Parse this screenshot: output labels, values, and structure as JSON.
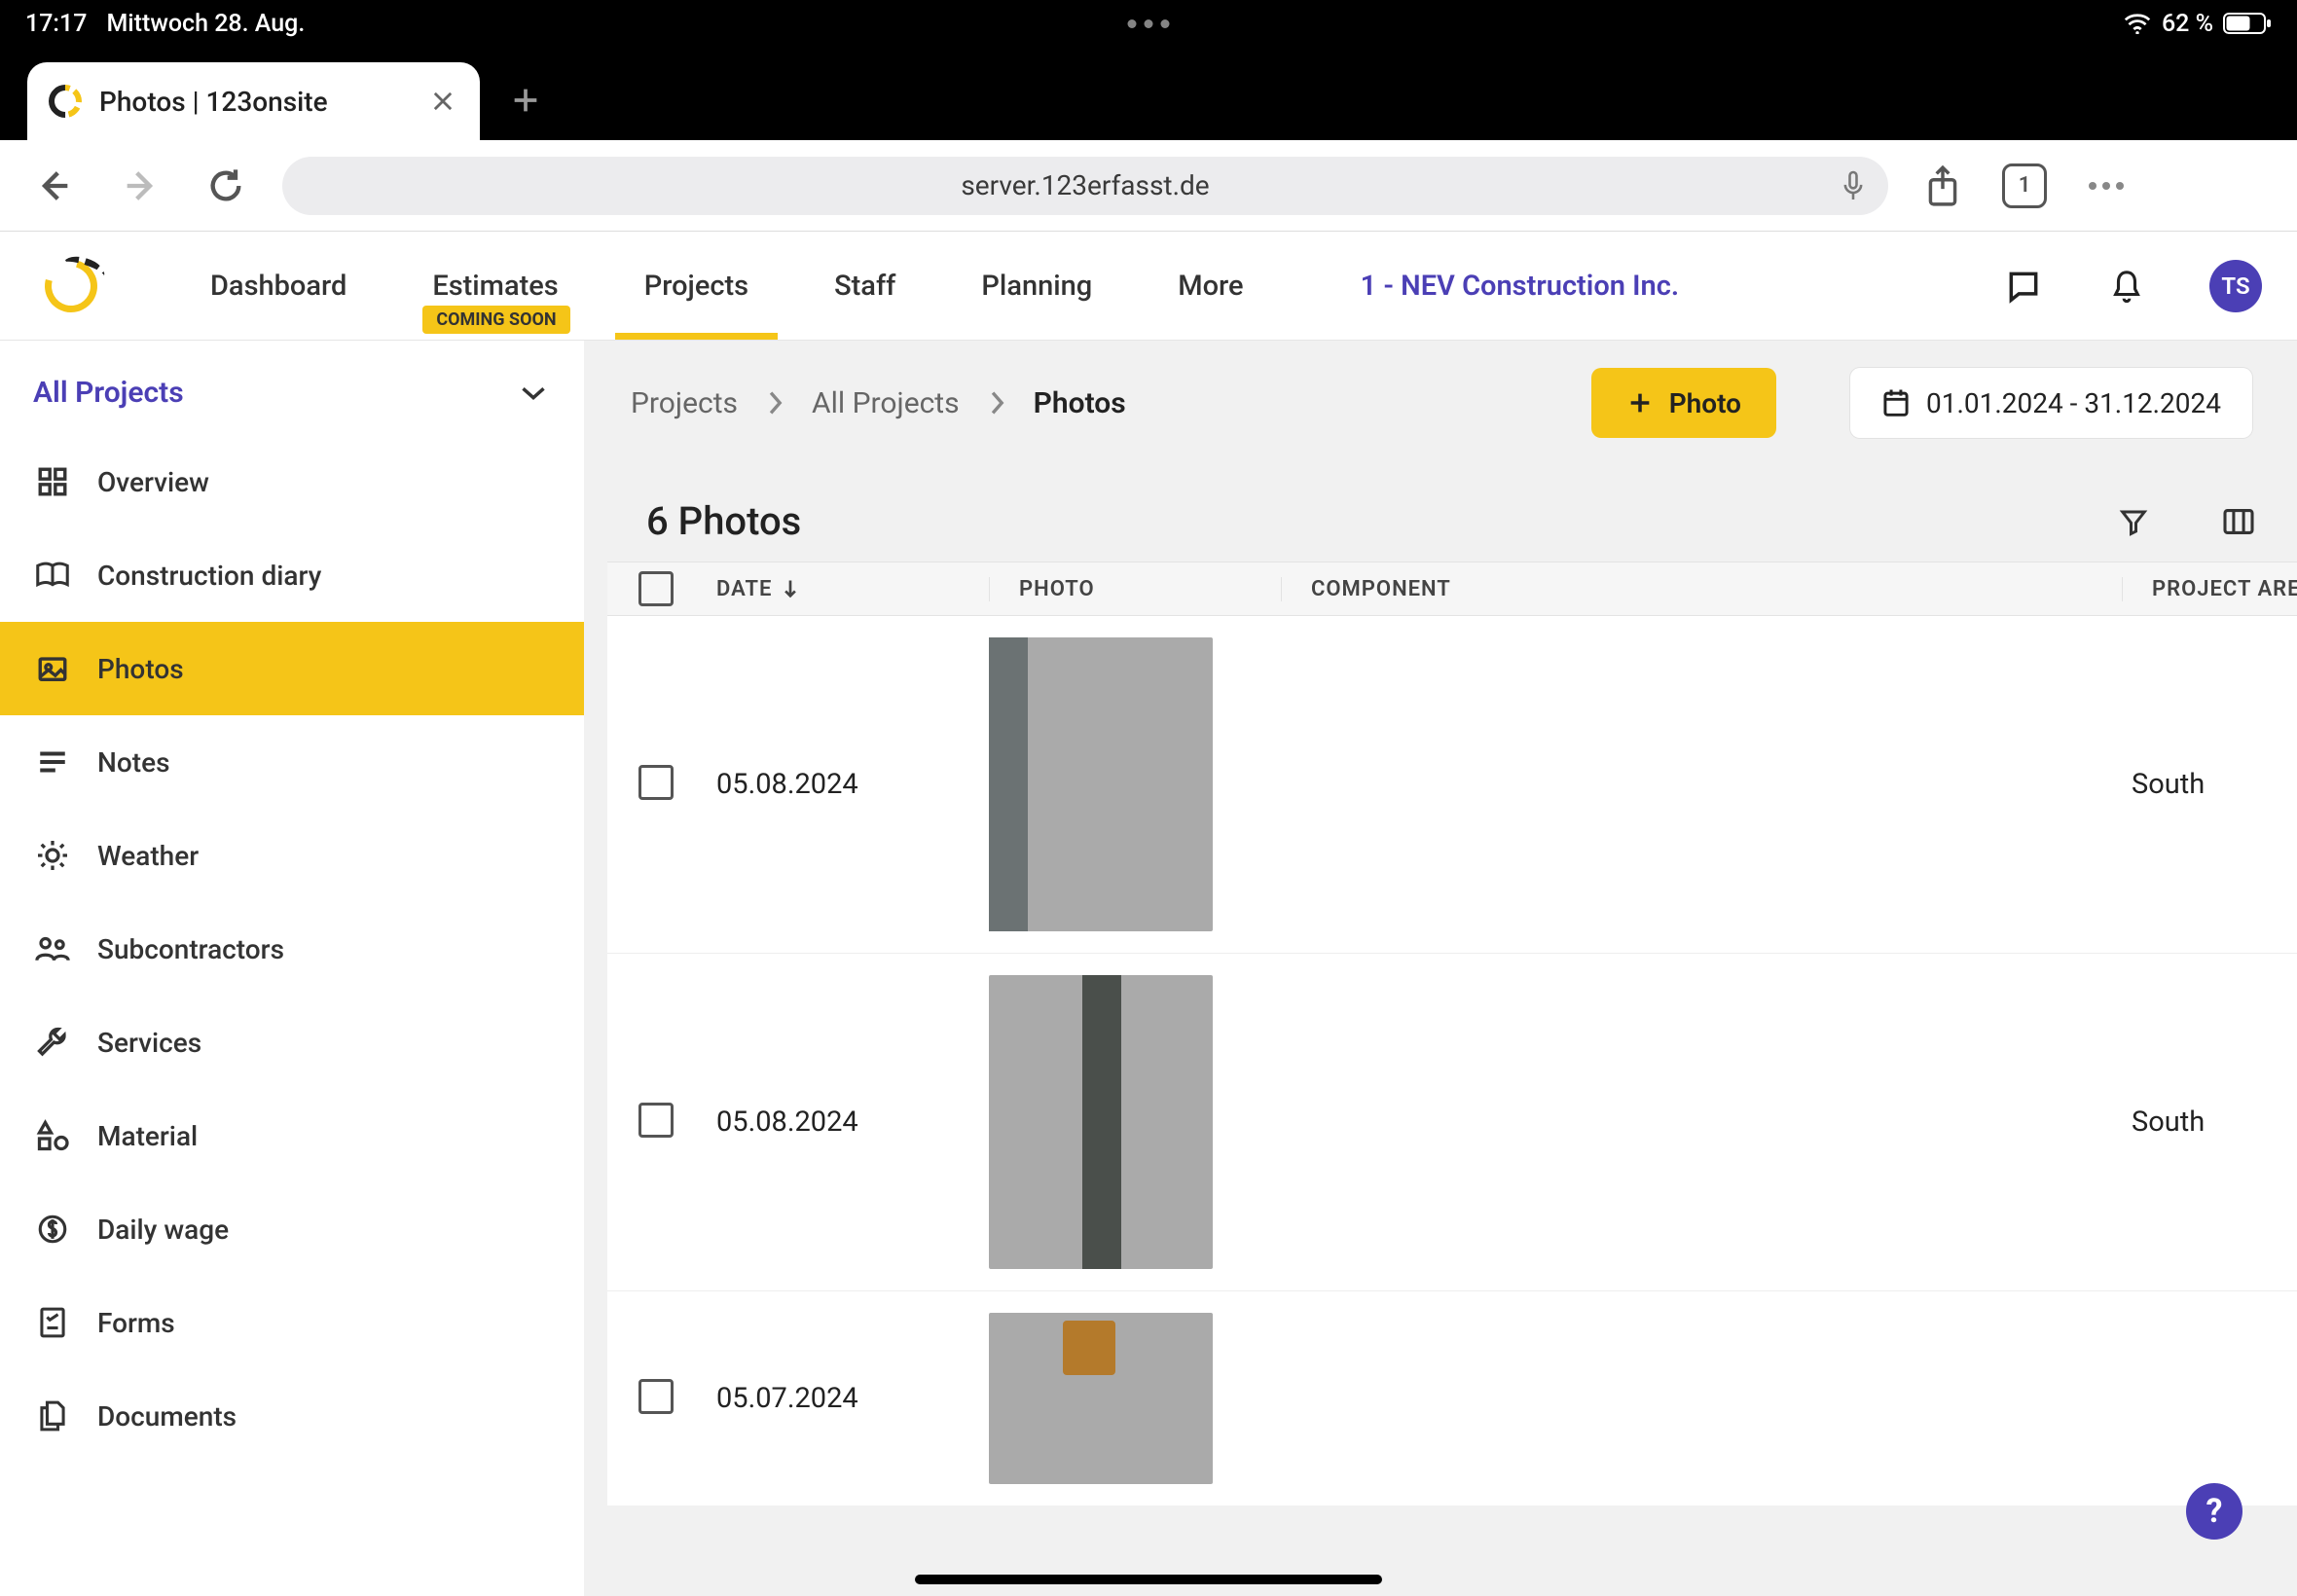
{
  "statusbar": {
    "time": "17:17",
    "date": "Mittwoch 28. Aug.",
    "battery": "62 %"
  },
  "browser": {
    "tab_title": "Photos | 123onsite",
    "address": "server.123erfasst.de",
    "tab_count": "1"
  },
  "nav": {
    "items": [
      "Dashboard",
      "Estimates",
      "Projects",
      "Staff",
      "Planning",
      "More"
    ],
    "badge": "COMING SOON",
    "company": "1 - NEV Construction Inc.",
    "avatar": "TS"
  },
  "sidebar": {
    "header": "All Projects",
    "items": [
      "Overview",
      "Construction diary",
      "Photos",
      "Notes",
      "Weather",
      "Subcontractors",
      "Services",
      "Material",
      "Daily wage",
      "Forms",
      "Documents"
    ]
  },
  "main": {
    "crumbs": [
      "Projects",
      "All Projects",
      "Photos"
    ],
    "add_button": "Photo",
    "date_range": "01.01.2024 - 31.12.2024",
    "list_title": "6 Photos",
    "columns": {
      "date": "DATE",
      "photo": "PHOTO",
      "component": "COMPONENT",
      "area": "PROJECT AREA"
    },
    "rows": [
      {
        "date": "05.08.2024",
        "area": "South"
      },
      {
        "date": "05.08.2024",
        "area": "South"
      },
      {
        "date": "05.07.2024",
        "area": ""
      }
    ]
  }
}
